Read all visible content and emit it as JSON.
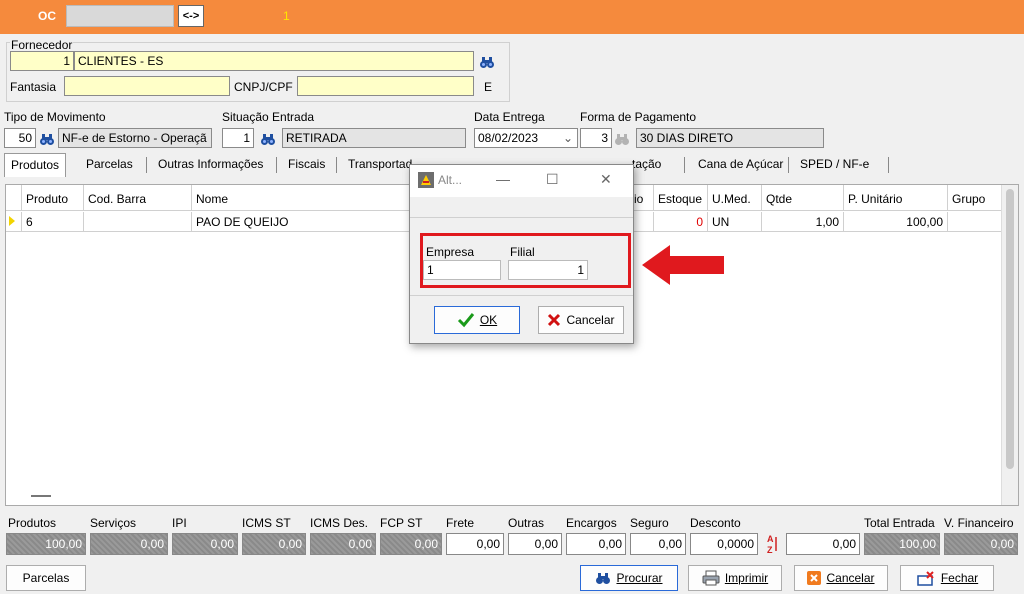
{
  "topbar": {
    "label": "OC",
    "number": "1",
    "swap_label": "<->"
  },
  "fornecedor": {
    "group_label": "Fornecedor",
    "code": "1",
    "name": "CLIENTES - ES",
    "fantasia_label": "Fantasia",
    "fantasia_value": "",
    "cnpj_label": "CNPJ/CPF",
    "cnpj_value": "",
    "uf": "E"
  },
  "movimento": {
    "tipo_label": "Tipo de Movimento",
    "tipo_code": "50",
    "tipo_desc": "NF-e de Estorno - Operaçã",
    "situacao_label": "Situação Entrada",
    "situacao_code": "1",
    "situacao_desc": "RETIRADA",
    "data_label": "Data Entrega",
    "data_value": "08/02/2023",
    "pagamento_label": "Forma de Pagamento",
    "pagamento_code": "3",
    "pagamento_desc": "30 DIAS DIRETO"
  },
  "tabs": [
    {
      "label": "Produtos"
    },
    {
      "label": "Parcelas"
    },
    {
      "label": "Outras Informações"
    },
    {
      "label": "Fiscais"
    },
    {
      "label": "Transportad"
    },
    {
      "label": "tação"
    },
    {
      "label": "Cana de Açúcar"
    },
    {
      "label": "SPED / NF-e"
    }
  ],
  "grid": {
    "columns": [
      "Produto",
      "Cod. Barra",
      "Nome",
      "rio",
      "Estoque",
      "U.Med.",
      "Qtde",
      "P. Unitário",
      "Grupo"
    ],
    "rows": [
      {
        "produto": "6",
        "cod_barra": "",
        "nome": "PAO DE QUEIJO",
        "estoque": "0",
        "umed": "UN",
        "qtde": "1,00",
        "p_unitario": "100,00",
        "grupo": ""
      }
    ]
  },
  "totals": {
    "labels": [
      "Produtos",
      "Serviços",
      "IPI",
      "ICMS ST",
      "ICMS Des.",
      "FCP ST",
      "Frete",
      "Outras",
      "Encargos",
      "Seguro",
      "Desconto",
      "Total Entrada",
      "V. Financeiro"
    ],
    "produtos": "100,00",
    "servicos": "0,00",
    "ipi": "0,00",
    "icms_st": "0,00",
    "icms_des": "0,00",
    "fcp_st": "0,00",
    "frete": "0,00",
    "outras": "0,00",
    "encargos": "0,00",
    "seguro": "0,00",
    "desconto_pct": "0,0000",
    "desconto": "0,00",
    "total_entrada": "100,00",
    "v_financeiro": "0,00"
  },
  "buttons": {
    "parcelas": "Parcelas",
    "procurar": "Procurar",
    "imprimir": "Imprimir",
    "cancelar": "Cancelar",
    "fechar": "Fechar"
  },
  "dialog": {
    "title": "Alt...",
    "empresa_label": "Empresa",
    "empresa_value": "1",
    "filial_label": "Filial",
    "filial_value": "1",
    "ok_label": "OK",
    "cancel_label": "Cancelar"
  },
  "colors": {
    "topbar": "#f58a3d",
    "highlight": "#e0191e",
    "field_yellow": "#ffffc8"
  }
}
